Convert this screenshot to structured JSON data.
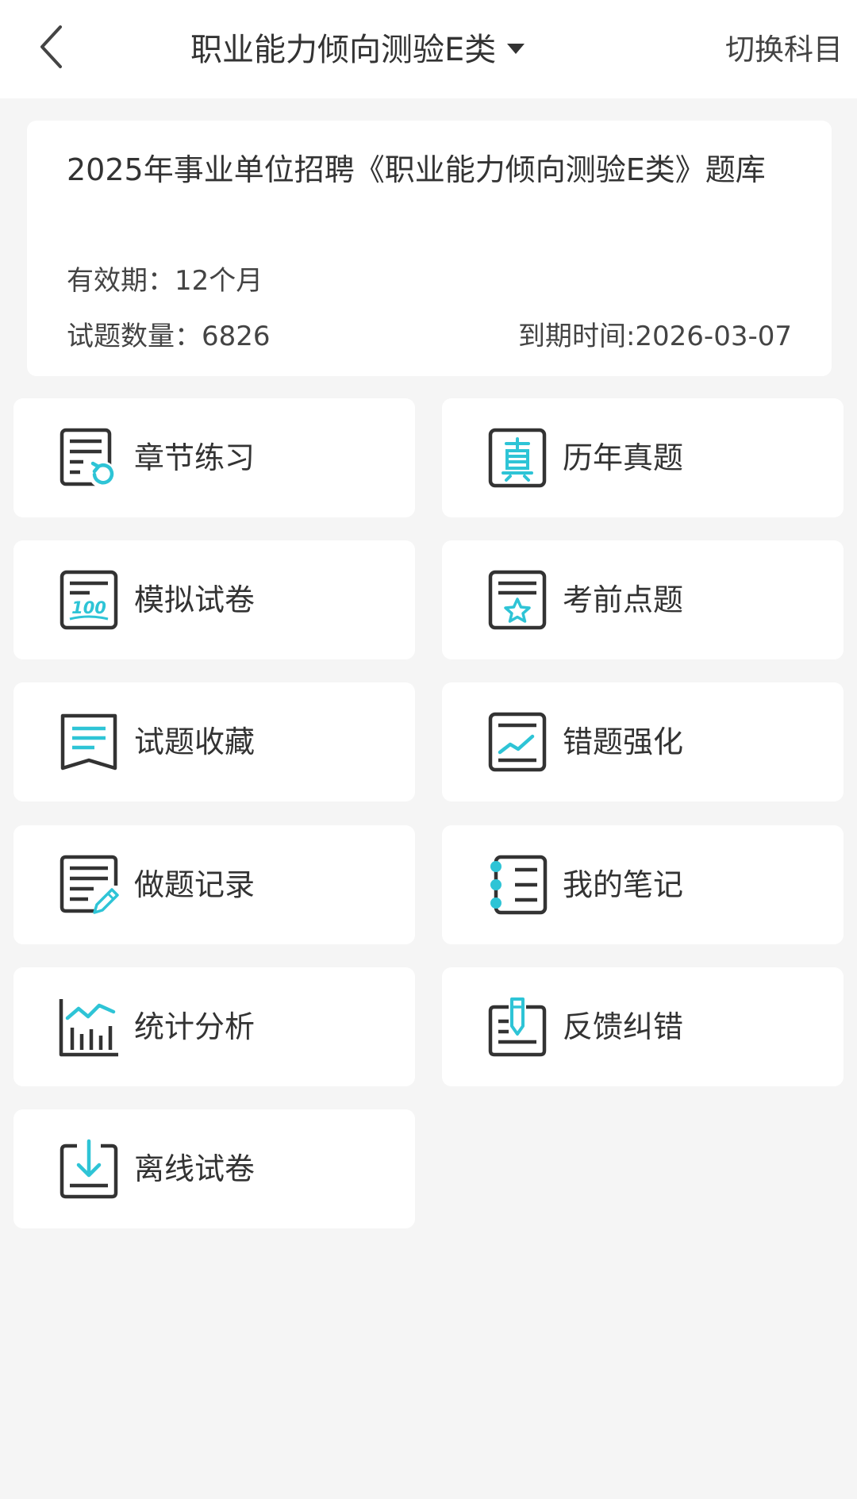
{
  "header": {
    "title": "职业能力倾向测验E类",
    "switch_label": "切换科目"
  },
  "bank": {
    "title": "2025年事业单位招聘《职业能力倾向测验E类》题库",
    "validity": "有效期：12个月",
    "question_count": "试题数量：6826",
    "expire": "到期时间:2026-03-07"
  },
  "menu": [
    {
      "label": "章节练习",
      "icon": "chapter-practice-icon"
    },
    {
      "label": "历年真题",
      "icon": "past-exam-icon"
    },
    {
      "label": "模拟试卷",
      "icon": "mock-paper-icon"
    },
    {
      "label": "考前点题",
      "icon": "pre-exam-star-icon"
    },
    {
      "label": "试题收藏",
      "icon": "bookmark-icon"
    },
    {
      "label": "错题强化",
      "icon": "trend-chart-icon"
    },
    {
      "label": "做题记录",
      "icon": "edit-record-icon"
    },
    {
      "label": "我的笔记",
      "icon": "notebook-icon"
    },
    {
      "label": "统计分析",
      "icon": "bar-chart-icon"
    },
    {
      "label": "反馈纠错",
      "icon": "feedback-pen-icon"
    },
    {
      "label": "离线试卷",
      "icon": "download-icon"
    }
  ],
  "colors": {
    "accent": "#2ec4d6",
    "icon_dark": "#333333",
    "background": "#f5f5f5",
    "card": "#ffffff"
  }
}
